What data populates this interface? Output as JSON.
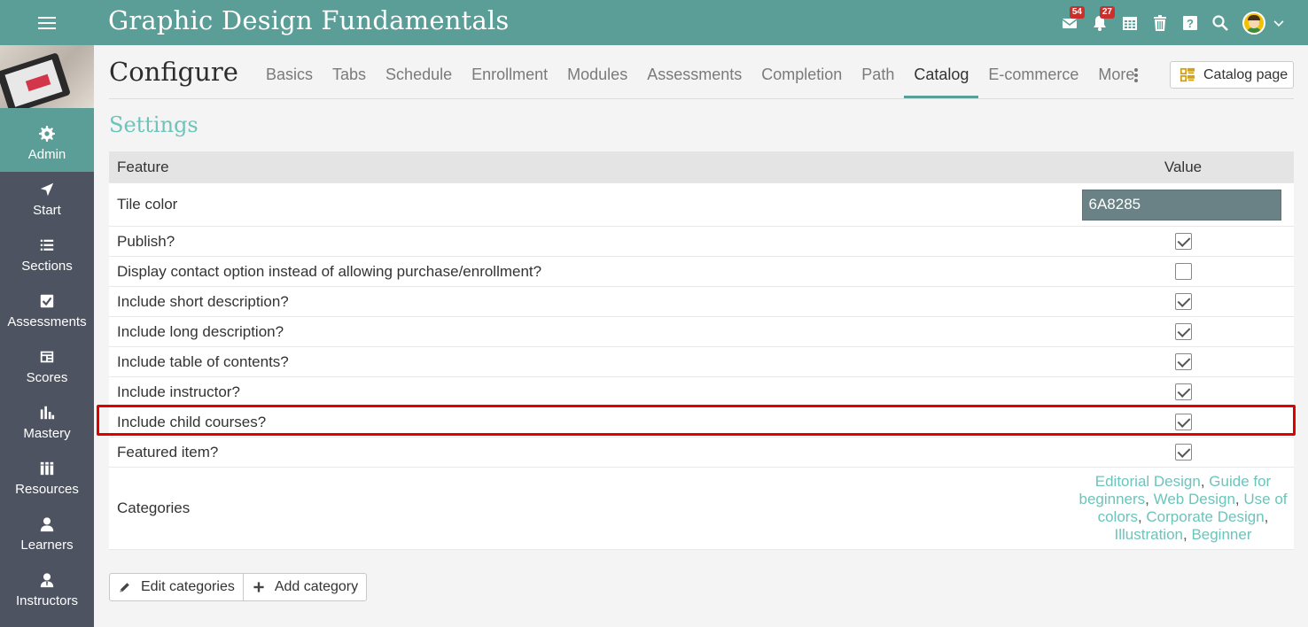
{
  "app": {
    "title": "Graphic Design Fundamentals"
  },
  "topbar": {
    "icons": [
      {
        "name": "messages-icon",
        "badge": "54"
      },
      {
        "name": "notifications-icon",
        "badge": "27"
      },
      {
        "name": "calendar-icon",
        "badge": ""
      },
      {
        "name": "trash-icon",
        "badge": ""
      },
      {
        "name": "help-icon",
        "badge": ""
      },
      {
        "name": "search-icon",
        "badge": ""
      }
    ]
  },
  "sidebar": {
    "items": [
      {
        "label": "Admin",
        "icon": "gear-icon",
        "active": true
      },
      {
        "label": "Start",
        "icon": "navigate-icon",
        "active": false
      },
      {
        "label": "Sections",
        "icon": "list-icon",
        "active": false
      },
      {
        "label": "Assessments",
        "icon": "checkbox-icon",
        "active": false
      },
      {
        "label": "Scores",
        "icon": "gradebook-icon",
        "active": false
      },
      {
        "label": "Mastery",
        "icon": "bar-chart-icon",
        "active": false
      },
      {
        "label": "Resources",
        "icon": "books-icon",
        "active": false
      },
      {
        "label": "Learners",
        "icon": "user-icon",
        "active": false
      },
      {
        "label": "Instructors",
        "icon": "instructor-icon",
        "active": false
      }
    ]
  },
  "page": {
    "title": "Configure",
    "tabs": [
      "Basics",
      "Tabs",
      "Schedule",
      "Enrollment",
      "Modules",
      "Assessments",
      "Completion",
      "Path",
      "Catalog",
      "E-commerce",
      "More"
    ],
    "active_tab": "Catalog",
    "catalog_button": "Catalog page"
  },
  "settings": {
    "title": "Settings",
    "col_feature": "Feature",
    "col_value": "Value",
    "tile_color_label": "Tile color",
    "tile_color_value": "6A8285",
    "rows": [
      {
        "label": "Publish?",
        "checked": true
      },
      {
        "label": "Display contact option instead of allowing purchase/enrollment?",
        "checked": false
      },
      {
        "label": "Include short description?",
        "checked": true
      },
      {
        "label": "Include long description?",
        "checked": true
      },
      {
        "label": "Include table of contents?",
        "checked": true
      },
      {
        "label": "Include instructor?",
        "checked": true
      },
      {
        "label": "Include child courses?",
        "checked": true
      },
      {
        "label": "Featured item?",
        "checked": true
      }
    ],
    "categories_label": "Categories",
    "categories": [
      "Editorial Design",
      "Guide for beginners",
      "Web Design",
      "Use of colors",
      "Corporate Design",
      "Illustration",
      "Beginner"
    ]
  },
  "actions": {
    "edit_categories": "Edit categories",
    "add_category": "Add category"
  },
  "colors": {
    "accent": "#5a9e97",
    "sidebar": "#4d5360",
    "link": "#6cc4bb",
    "tile": "#6A8285",
    "highlight": "#e00000"
  }
}
